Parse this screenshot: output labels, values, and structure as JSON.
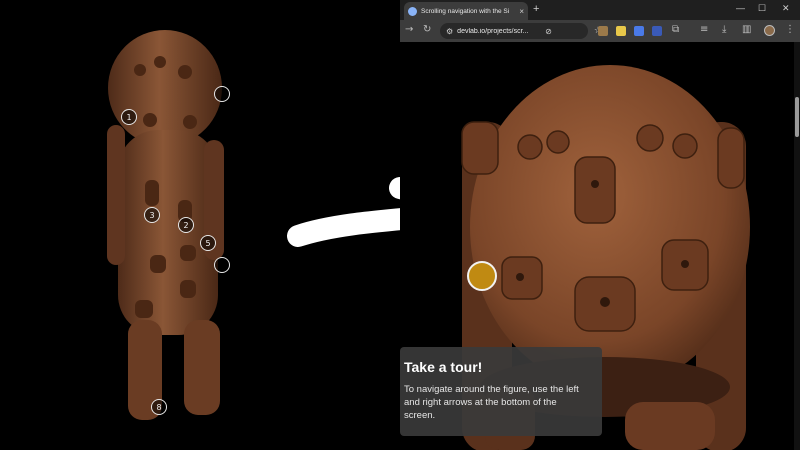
{
  "viewer": {
    "hotspots": [
      "1",
      "2",
      "3",
      "5",
      "8"
    ]
  },
  "browser": {
    "tab_title": "Scrolling navigation with the Si",
    "tab_close": "×",
    "new_tab": "+",
    "window_controls": [
      "—",
      "☐",
      "✕"
    ],
    "url": "devlab.io/projects/scr...",
    "site_icon": "⚙",
    "eye_icon": "⊘",
    "star_icon": "☆"
  },
  "tour": {
    "title": "Take a tour!",
    "body": "To navigate around the figure, use the left and right arrows at the bottom of the screen."
  },
  "colors": {
    "hotspot_accent": "#c08a12",
    "wood": "#7a4a2e",
    "tour_panel": "#3a3a3a"
  }
}
